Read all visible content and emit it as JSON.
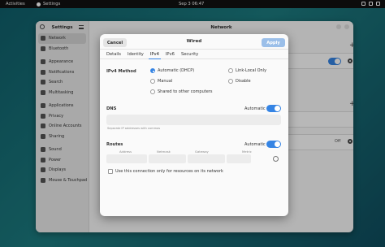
{
  "topbar": {
    "activities": "Activities",
    "app": "Settings",
    "clock": "Sep 3  06:47"
  },
  "sidebar": {
    "title": "Settings",
    "items": [
      {
        "label": "Network",
        "icon": "network-icon",
        "selected": true
      },
      {
        "label": "Bluetooth",
        "icon": "bluetooth-icon"
      },
      {
        "label": "Appearance",
        "icon": "appearance-icon"
      },
      {
        "label": "Notifications",
        "icon": "bell-icon"
      },
      {
        "label": "Search",
        "icon": "search-icon"
      },
      {
        "label": "Multitasking",
        "icon": "multitasking-icon"
      },
      {
        "label": "Applications",
        "icon": "apps-icon"
      },
      {
        "label": "Privacy",
        "icon": "privacy-icon"
      },
      {
        "label": "Online Accounts",
        "icon": "accounts-icon"
      },
      {
        "label": "Sharing",
        "icon": "sharing-icon"
      },
      {
        "label": "Sound",
        "icon": "sound-icon"
      },
      {
        "label": "Power",
        "icon": "power-icon"
      },
      {
        "label": "Displays",
        "icon": "display-icon"
      },
      {
        "label": "Mouse & Touchpad",
        "icon": "mouse-icon"
      }
    ]
  },
  "main": {
    "title": "Network",
    "off_label": "Off"
  },
  "dialog": {
    "title": "Wired",
    "cancel": "Cancel",
    "apply": "Apply",
    "tabs": [
      "Details",
      "Identity",
      "IPv4",
      "IPv6",
      "Security"
    ],
    "active_tab": "IPv4",
    "ipv4_method_label": "IPv4 Method",
    "methods": [
      {
        "label": "Automatic (DHCP)",
        "selected": true
      },
      {
        "label": "Link-Local Only",
        "selected": false
      },
      {
        "label": "Manual",
        "selected": false
      },
      {
        "label": "Disable",
        "selected": false
      },
      {
        "label": "Shared to other computers",
        "selected": false
      }
    ],
    "dns_label": "DNS",
    "automatic": "Automatic",
    "dns_hint": "Separate IP addresses with commas",
    "routes_label": "Routes",
    "route_columns": [
      "Address",
      "Netmask",
      "Gateway",
      "Metric"
    ],
    "only_resources": "Use this connection only for resources on its network"
  },
  "colors": {
    "accent": "#3584e4",
    "apply_disabled": "#9bbfe9"
  }
}
